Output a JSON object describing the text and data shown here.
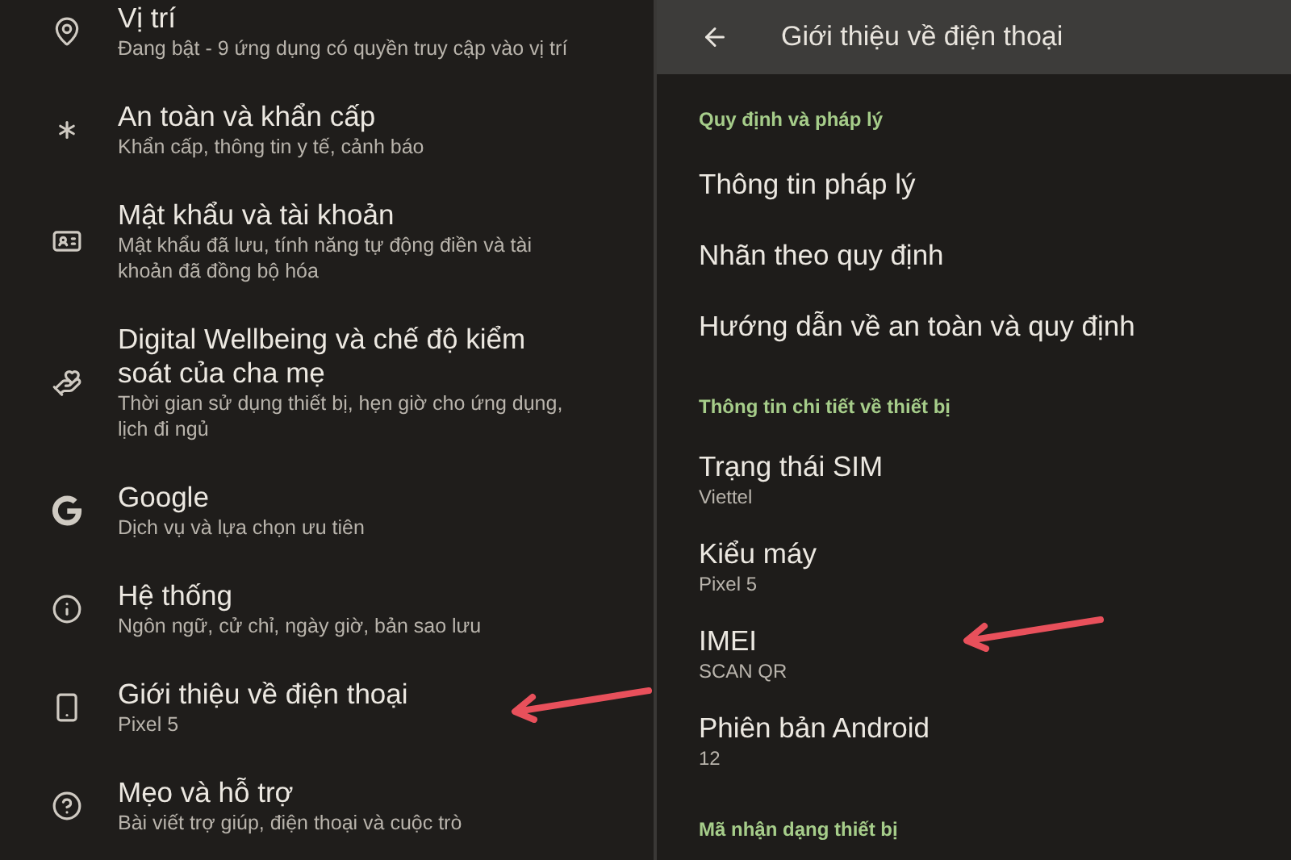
{
  "settings_list": {
    "items": [
      {
        "title": "Vị trí",
        "subtitle": "Đang bật - 9 ứng dụng có quyền truy cập vào vị trí"
      },
      {
        "title": "An toàn và khẩn cấp",
        "subtitle": "Khẩn cấp, thông tin y tế, cảnh báo"
      },
      {
        "title": "Mật khẩu và tài khoản",
        "subtitle": "Mật khẩu đã lưu, tính năng tự động điền và tài khoản đã đồng bộ hóa"
      },
      {
        "title": "Digital Wellbeing và chế độ kiểm soát của cha mẹ",
        "subtitle": "Thời gian sử dụng thiết bị, hẹn giờ cho ứng dụng, lịch đi ngủ"
      },
      {
        "title": "Google",
        "subtitle": "Dịch vụ và lựa chọn ưu tiên"
      },
      {
        "title": "Hệ thống",
        "subtitle": "Ngôn ngữ, cử chỉ, ngày giờ, bản sao lưu"
      },
      {
        "title": "Giới thiệu về điện thoại",
        "subtitle": "Pixel 5"
      },
      {
        "title": "Mẹo và hỗ trợ",
        "subtitle": "Bài viết trợ giúp, điện thoại và cuộc trò"
      }
    ]
  },
  "about_phone": {
    "title": "Giới thiệu về điện thoại",
    "items": [
      {
        "kind": "header",
        "title": "Quy định và pháp lý"
      },
      {
        "kind": "item",
        "title": "Thông tin pháp lý"
      },
      {
        "kind": "item",
        "title": "Nhãn theo quy định"
      },
      {
        "kind": "item",
        "title": "Hướng dẫn về an toàn và quy định"
      },
      {
        "kind": "header",
        "title": "Thông tin chi tiết về thiết bị"
      },
      {
        "kind": "item",
        "title": "Trạng thái SIM",
        "subtitle": "Viettel"
      },
      {
        "kind": "item",
        "title": "Kiểu máy",
        "subtitle": "Pixel 5"
      },
      {
        "kind": "item",
        "title": "IMEI",
        "subtitle": "SCAN QR"
      },
      {
        "kind": "item",
        "title": "Phiên bản Android",
        "subtitle": "12"
      },
      {
        "kind": "header",
        "title": "Mã nhận dạng thiết bị"
      }
    ]
  }
}
